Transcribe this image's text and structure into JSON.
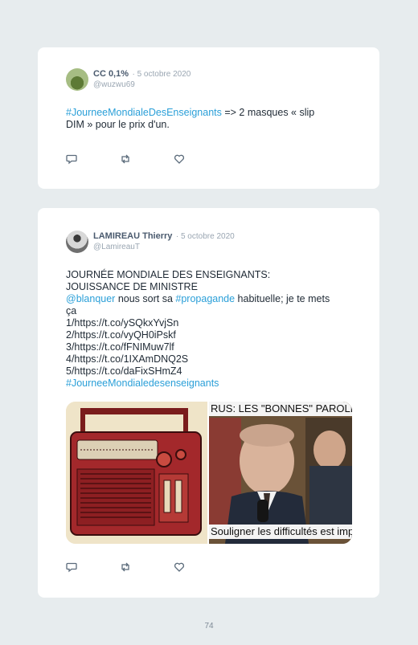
{
  "tweets": [
    {
      "author": "CC 0,1%",
      "date": "· 5 octobre 2020",
      "handle": "@wuzwu69",
      "lines": [
        {
          "hashtag": "#JourneeMondialeDesEnseignants",
          "rest": " => 2 masques « slip"
        },
        {
          "text": "DIM » pour le prix d'un."
        }
      ]
    },
    {
      "author": "LAMIREAU Thierry",
      "date": "· 5 octobre 2020",
      "handle": "@LamireauT",
      "lines": [
        {
          "text": "JOURNÉE MONDIALE DES ENSEIGNANTS:"
        },
        {
          "text": "JOUISSANCE DE MINISTRE"
        },
        {
          "mention": "@blanquer",
          "mid": " nous sort sa ",
          "hashtag": "#propagande",
          "rest": " habituelle; je te mets"
        },
        {
          "text": "ça"
        },
        {
          "text": "1/https://t.co/ySQkxYvjSn"
        },
        {
          "text": "2/https://t.co/vyQH0iPskf"
        },
        {
          "text": "3/https://t.co/fFNIMuw7lf"
        },
        {
          "text": "4/https://t.co/1IXAmDNQ2S"
        },
        {
          "text": "5/https://t.co/daFixSHmZ4"
        },
        {
          "hashtag": "#JourneeMondialedesenseignants"
        }
      ],
      "media": {
        "caption_top": "RUS: LES \"BONNES\" PAROLES",
        "caption_bottom": "Souligner les difficultés est important"
      }
    }
  ],
  "actions": {
    "icons": [
      "reply-icon",
      "retweet-icon",
      "like-icon"
    ]
  },
  "colors": {
    "link": "#2a9fd8",
    "background": "#e7ecee",
    "card": "#ffffff"
  },
  "page_number": "74"
}
